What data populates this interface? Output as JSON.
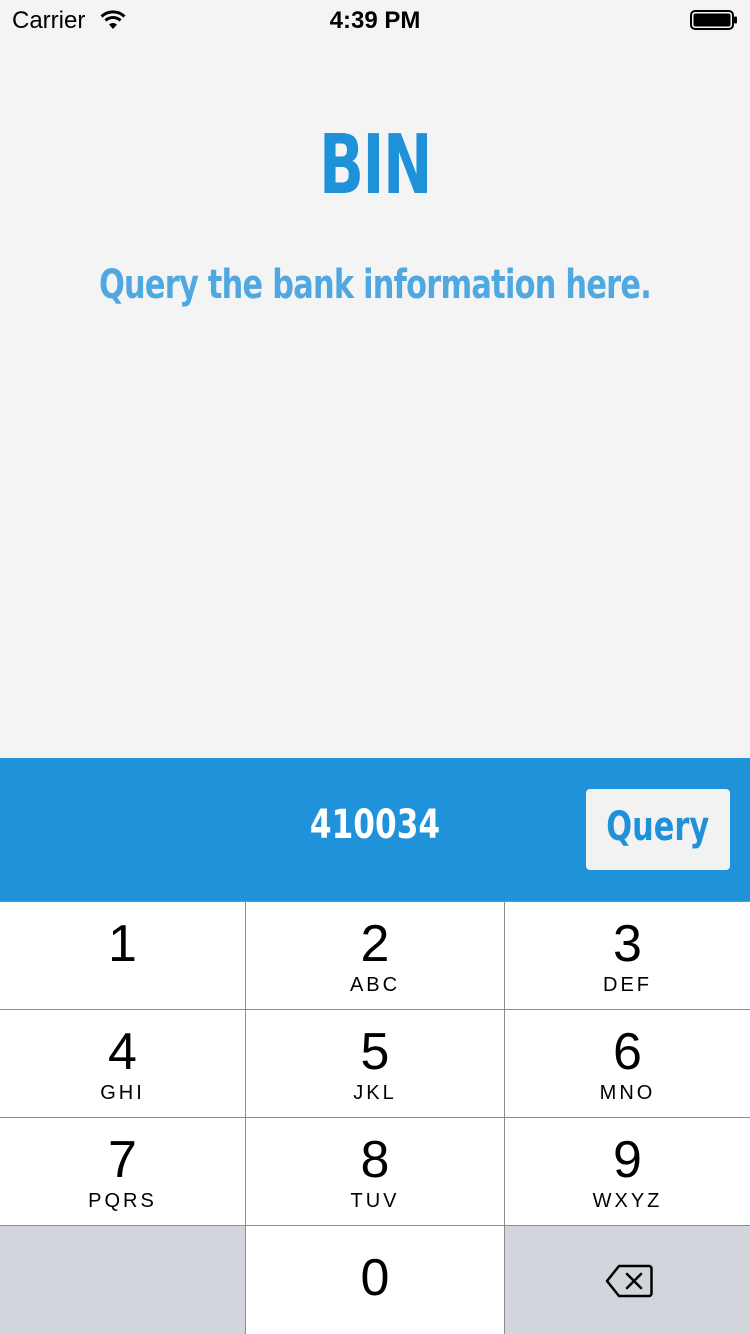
{
  "status_bar": {
    "carrier": "Carrier",
    "time": "4:39 PM",
    "wifi_icon": "wifi-icon",
    "battery_icon": "battery-icon"
  },
  "header": {
    "title": "BIN",
    "subtitle": "Query the bank information here."
  },
  "query_bar": {
    "input_value": "410034",
    "button_label": "Query"
  },
  "keypad": {
    "keys": [
      {
        "digit": "1",
        "letters": ""
      },
      {
        "digit": "2",
        "letters": "ABC"
      },
      {
        "digit": "3",
        "letters": "DEF"
      },
      {
        "digit": "4",
        "letters": "GHI"
      },
      {
        "digit": "5",
        "letters": "JKL"
      },
      {
        "digit": "6",
        "letters": "MNO"
      },
      {
        "digit": "7",
        "letters": "PQRS"
      },
      {
        "digit": "8",
        "letters": "TUV"
      },
      {
        "digit": "9",
        "letters": "WXYZ"
      },
      {
        "digit": "0",
        "letters": ""
      }
    ],
    "delete_icon": "backspace-icon"
  },
  "colors": {
    "accent": "#1f92da",
    "background": "#f4f4f4",
    "subtitle": "#4fa8e0",
    "key_gray": "#d2d5db"
  }
}
